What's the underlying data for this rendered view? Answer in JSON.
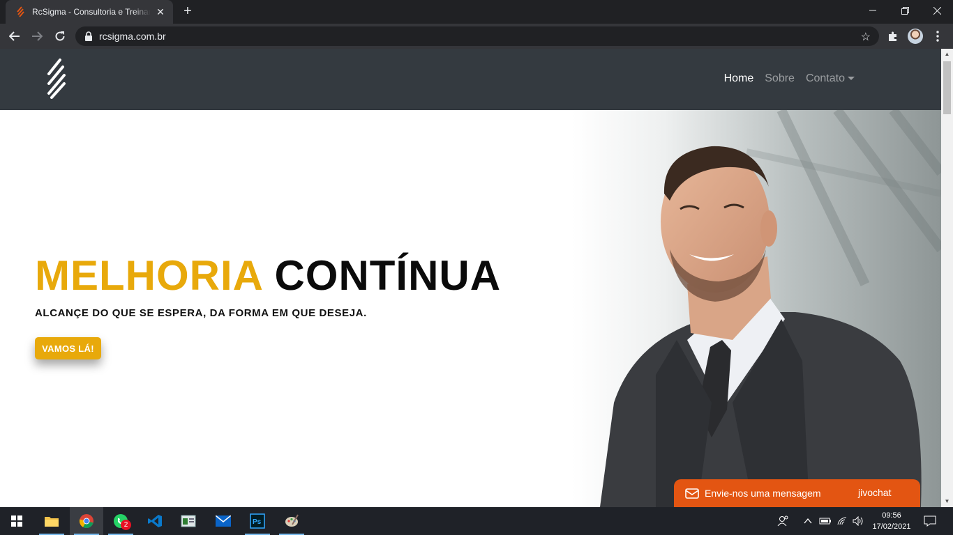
{
  "browser": {
    "tab_title": "RcSigma - Consultoria e Treinamentos",
    "tab_close": "✕",
    "new_tab": "+",
    "url": "rcsigma.com.br"
  },
  "nav": {
    "home": "Home",
    "sobre": "Sobre",
    "contato": "Contato"
  },
  "hero": {
    "headline_accent": "MELHORIA",
    "headline_main": "CONTÍNUA",
    "subheadline": "ALCANÇE DO QUE SE ESPERA, DA FORMA EM QUE DESEJA.",
    "cta": "VAMOS LÁ!"
  },
  "chat": {
    "message": "Envie-nos uma mensagem",
    "brand": "jivochat"
  },
  "taskbar": {
    "whatsapp_badge": "2",
    "time": "09:56",
    "date": "17/02/2021"
  },
  "colors": {
    "accent": "#e8a90b",
    "navbar": "#343a40",
    "chat": "#e35512"
  }
}
